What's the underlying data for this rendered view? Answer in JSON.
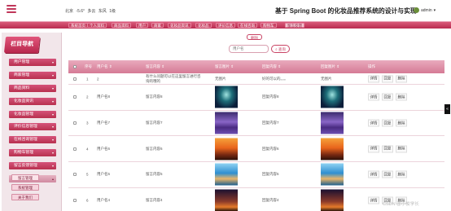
{
  "header": {
    "weather": [
      "北京",
      "-5.6°",
      "多云",
      "东风",
      "1级"
    ],
    "title": "基于 Spring Boot 的化妆品推荐系统的设计与实现",
    "user": "admin",
    "user_arrow": "▾"
  },
  "nav": {
    "items": [
      "系统首页",
      "个人资料",
      "商品资料",
      "用户",
      "商家",
      "化妆品资讯",
      "化妆品",
      "评价信息",
      "在线咨询",
      "购物车",
      "留言反馈"
    ],
    "active_index": 10
  },
  "sidebar": {
    "heading": "栏目导航",
    "items": [
      "用户管理",
      "商家管理",
      "商品资料",
      "化妆品资讯",
      "化妆品管理",
      "评价信息管理",
      "在线咨询管理",
      "购物车管理",
      "留言反馈管理",
      "留言反馈"
    ],
    "open_arrow": "▴",
    "closed_arrow": "▾",
    "sub_items": [
      "留言管理",
      "系统管理",
      "关于我们"
    ]
  },
  "search": {
    "tag": "删除",
    "placeholder": "用户名",
    "button": "查询"
  },
  "table": {
    "headers": [
      "序号",
      "用户名 ⇕",
      "留言内容 ⇕",
      "留言图片 ⇕",
      "回复内容 ⇕",
      "回复图片 ⇕",
      "操作"
    ],
    "actions": [
      "详情",
      "回复",
      "删除"
    ],
    "rows": [
      {
        "no": "1",
        "user": "2",
        "content": "有什么问题可以在这里留言进行咨询的哦的",
        "image_text": "无图片",
        "reply": "好的可以的。。。",
        "reply_image_text": "无图片"
      },
      {
        "no": "2",
        "user": "用户名8",
        "content": "留言内容8",
        "reply": "回复内容8",
        "image": "teal-night"
      },
      {
        "no": "3",
        "user": "用户名7",
        "content": "留言内容7",
        "reply": "回复内容7",
        "image": "purple-field"
      },
      {
        "no": "4",
        "user": "用户名6",
        "content": "留言内容6",
        "reply": "回复内容6",
        "image": "orange-sunset"
      },
      {
        "no": "5",
        "user": "用户名5",
        "content": "留言内容5",
        "reply": "回复内容5",
        "image": "blue-coast"
      },
      {
        "no": "6",
        "user": "用户名4",
        "content": "留言内容4",
        "reply": "回复内容4",
        "image": "dusk"
      }
    ]
  },
  "scroll_handle": "«",
  "watermark": "CSDN @小俊学长",
  "colors": {
    "accent": "#c94465",
    "nav": "#b92c50",
    "header_row": "#d57a95"
  }
}
